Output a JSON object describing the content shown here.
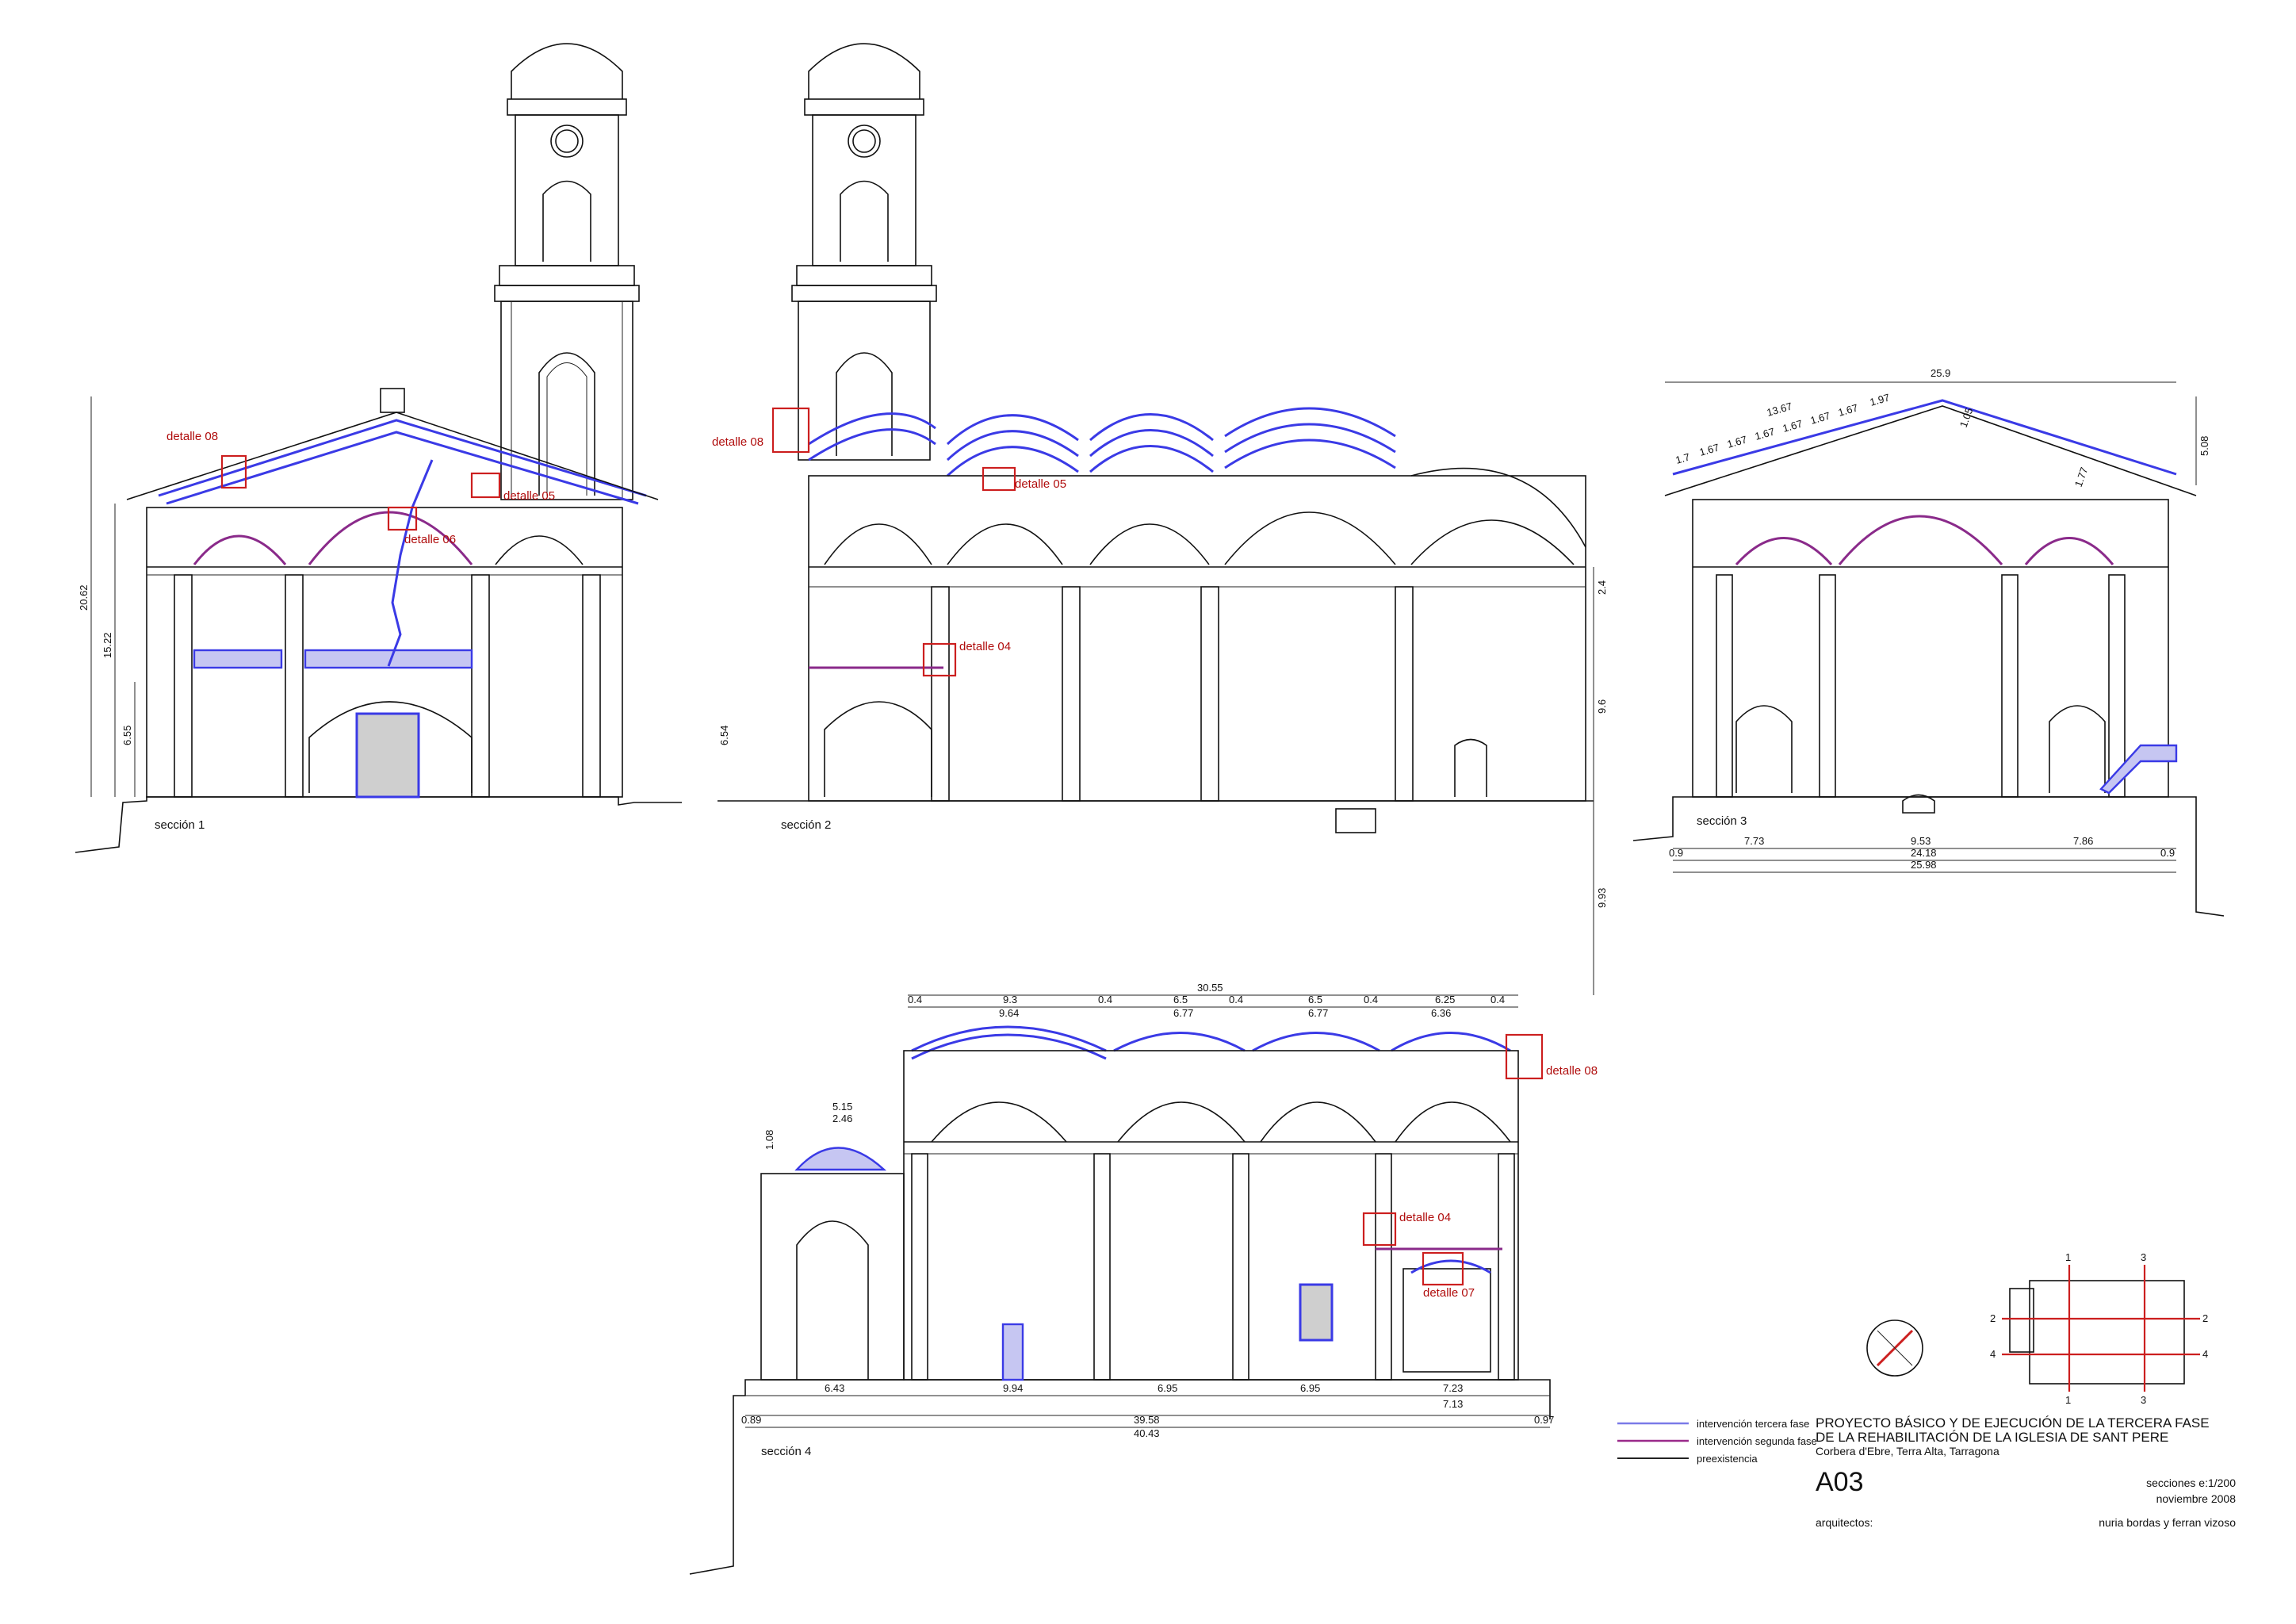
{
  "sections": {
    "s1": {
      "label": "sección 1",
      "dims": [
        "20.62",
        "15.22",
        "6.55"
      ],
      "details": [
        "detalle 08",
        "detalle 05",
        "detalle 06"
      ]
    },
    "s2": {
      "label": "sección 2",
      "dims": [
        "2.4",
        "9.6",
        "6.54",
        "9.93"
      ],
      "details": [
        "detalle 08",
        "detalle 05",
        "detalle 04"
      ]
    },
    "s3": {
      "label": "sección 3",
      "top": "25.9",
      "roof": [
        "1.7",
        "1.67",
        "1.67",
        "1.67",
        "1.67",
        "1.67",
        "1.67",
        "1.97",
        "13.67",
        "1.05",
        "1.77"
      ],
      "right": "5.08",
      "bottom": [
        "0.9",
        "7.73",
        "9.53",
        "7.86",
        "0.9",
        "24.18",
        "25.98"
      ]
    },
    "s4": {
      "label": "sección 4",
      "top_total": "30.55",
      "top": [
        "0.4",
        "9.3",
        "0.4",
        "6.5",
        "0.4",
        "6.5",
        "0.4",
        "6.25",
        "0.4"
      ],
      "arcs": [
        "9.64",
        "6.77",
        "6.77",
        "6.36"
      ],
      "dome": [
        "5.15",
        "2.46",
        "1.08"
      ],
      "bottom": [
        "6.43",
        "9.94",
        "6.95",
        "6.95",
        "7.23",
        "7.13",
        "0.89",
        "39.58",
        "0.97",
        "40.43"
      ],
      "details": [
        "detalle 08",
        "detalle 04",
        "detalle 07"
      ]
    }
  },
  "legend": [
    {
      "label": "intervención tercera fase",
      "color": "#7a7ae8"
    },
    {
      "label": "intervención segunda fase",
      "color": "#9a2a8a"
    },
    {
      "label": "preexistencia",
      "color": "#222222"
    }
  ],
  "title_block": {
    "title_line1": "PROYECTO BÁSICO Y DE EJECUCIÓN DE LA TERCERA FASE",
    "title_line2": "DE LA REHABILITACIÓN DE LA IGLESIA DE SANT PERE",
    "location": "Corbera d'Ebre, Terra Alta, Tarragona",
    "sheet": "A03",
    "scale": "secciones e:1/200",
    "date": "noviembre 2008",
    "architects_label": "arquitectos:",
    "architects": "nuria bordas y ferran vizoso"
  },
  "key_plan": {
    "marks": [
      "1",
      "3",
      "2",
      "2",
      "4",
      "4",
      "1",
      "3"
    ]
  },
  "colors": {
    "third_phase": "#3a3ae6",
    "second_phase": "#8a2a8a",
    "detail": "#cc1f1f"
  }
}
